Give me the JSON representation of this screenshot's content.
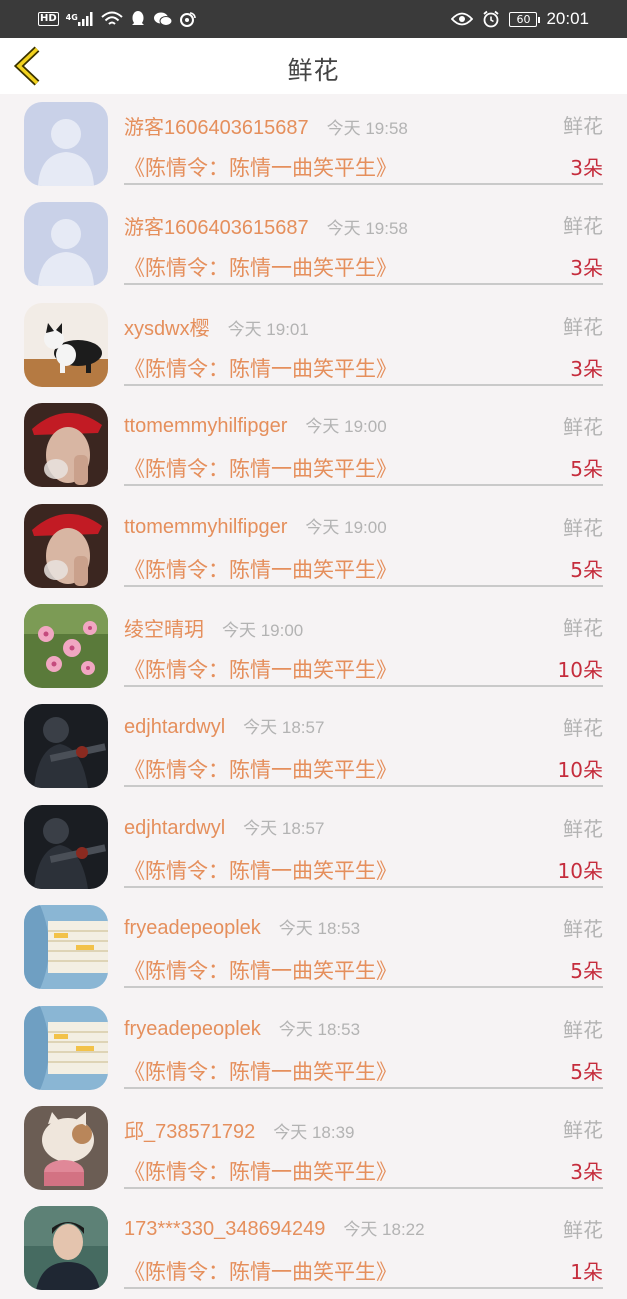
{
  "status_bar": {
    "hd": "HD",
    "network": "4G",
    "battery": "60",
    "time": "20:01"
  },
  "header": {
    "title": "鲜花"
  },
  "entries": [
    {
      "user": "游客1606403615687",
      "time": "今天 19:58",
      "gift": "鲜花",
      "book": "《陈情令：陈情一曲笑平生》",
      "count": "3朵",
      "avatar": "default-avatar"
    },
    {
      "user": "游客1606403615687",
      "time": "今天 19:58",
      "gift": "鲜花",
      "book": "《陈情令：陈情一曲笑平生》",
      "count": "3朵",
      "avatar": "default-avatar"
    },
    {
      "user": "xysdwx樱",
      "time": "今天 19:01",
      "gift": "鲜花",
      "book": "《陈情令：陈情一曲笑平生》",
      "count": "3朵",
      "avatar": "cat-photo"
    },
    {
      "user": "ttomemmyhilfipger",
      "time": "今天 19:00",
      "gift": "鲜花",
      "book": "《陈情令：陈情一曲笑平生》",
      "count": "5朵",
      "avatar": "red-hat-photo"
    },
    {
      "user": "ttomemmyhilfipger",
      "time": "今天 19:00",
      "gift": "鲜花",
      "book": "《陈情令：陈情一曲笑平生》",
      "count": "5朵",
      "avatar": "red-hat-photo"
    },
    {
      "user": "绫空晴玥",
      "time": "今天 19:00",
      "gift": "鲜花",
      "book": "《陈情令：陈情一曲笑平生》",
      "count": "10朵",
      "avatar": "flower-photo"
    },
    {
      "user": "edjhtardwyl",
      "time": "今天 18:57",
      "gift": "鲜花",
      "book": "《陈情令：陈情一曲笑平生》",
      "count": "10朵",
      "avatar": "soldier-photo"
    },
    {
      "user": "edjhtardwyl",
      "time": "今天 18:57",
      "gift": "鲜花",
      "book": "《陈情令：陈情一曲笑平生》",
      "count": "10朵",
      "avatar": "soldier-photo"
    },
    {
      "user": "fryeadepeoplek",
      "time": "今天 18:53",
      "gift": "鲜花",
      "book": "《陈情令：陈情一曲笑平生》",
      "count": "5朵",
      "avatar": "chart-photo"
    },
    {
      "user": "fryeadepeoplek",
      "time": "今天 18:53",
      "gift": "鲜花",
      "book": "《陈情令：陈情一曲笑平生》",
      "count": "5朵",
      "avatar": "chart-photo"
    },
    {
      "user": "邱_738571792",
      "time": "今天 18:39",
      "gift": "鲜花",
      "book": "《陈情令：陈情一曲笑平生》",
      "count": "3朵",
      "avatar": "cat-cake-photo"
    },
    {
      "user": "173***330_348694249",
      "time": "今天 18:22",
      "gift": "鲜花",
      "book": "《陈情令：陈情一曲笑平生》",
      "count": "1朵",
      "avatar": "man-photo"
    }
  ]
}
